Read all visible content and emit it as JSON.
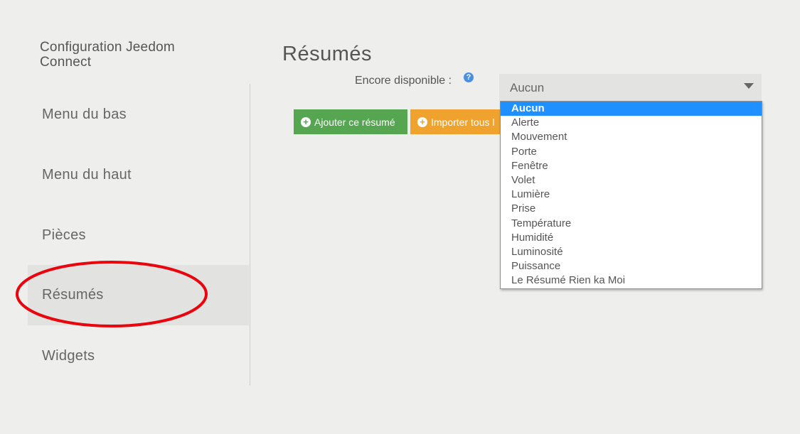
{
  "app": {
    "title": "Configuration Jeedom Connect"
  },
  "sidebar": {
    "items": [
      {
        "label": "Menu du bas"
      },
      {
        "label": "Menu du haut"
      },
      {
        "label": "Pièces"
      },
      {
        "label": "Résumés"
      },
      {
        "label": "Widgets"
      }
    ],
    "active_index": 3,
    "highlight_color": "#e8050d"
  },
  "main": {
    "title": "Résumés",
    "available_label": "Encore disponible :",
    "help_symbol": "?",
    "select": {
      "value": "Aucun",
      "options": [
        "Aucun",
        "Alerte",
        "Mouvement",
        "Porte",
        "Fenêtre",
        "Volet",
        "Lumière",
        "Prise",
        "Température",
        "Humidité",
        "Luminosité",
        "Puissance",
        "Le Résumé Rien ka Moi"
      ]
    },
    "buttons": {
      "add_label": "Ajouter ce résumé",
      "import_label": "Importer tous l",
      "add_color": "#55a551",
      "import_color": "#f0a22e"
    }
  }
}
